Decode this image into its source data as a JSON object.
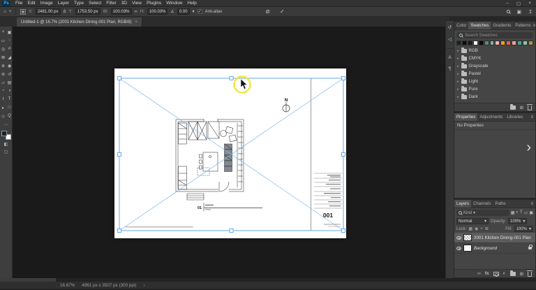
{
  "app": {
    "logo_text": "Ps",
    "minimize": "–",
    "restore": "▢",
    "close": "×"
  },
  "menubar": {
    "items": [
      "File",
      "Edit",
      "Image",
      "Layer",
      "Type",
      "Select",
      "Filter",
      "3D",
      "View",
      "Plugins",
      "Window",
      "Help"
    ]
  },
  "options": {
    "home_glyph": "⌂",
    "tool_glyph": "+",
    "caret": "▾",
    "x_label": "X:",
    "x_value": "2481.00 px",
    "delta_glyph": "Δ",
    "y_label": "Y:",
    "y_value": "1753.50 px",
    "w_label": "W:",
    "w_value": "100.03%",
    "link_glyph": "∞",
    "h_label": "H:",
    "h_value": "100.03%",
    "angle_glyph": "∠",
    "angle_value": "0.00",
    "antialias_check": "✓",
    "antialias_label": "Anti-alias",
    "cancel_glyph": "⊘",
    "commit_glyph": "✓",
    "workspace_glyph": "▣",
    "share_glyph": "↥"
  },
  "document_tab": {
    "title": "Untitled-1 @ 16.7% (2001 Kitchen Dining-001 Plan, RGB/8)",
    "close_glyph": "×"
  },
  "tools": {
    "items": [
      {
        "name": "move",
        "glyph": "+"
      },
      {
        "name": "artboard",
        "glyph": "▣"
      },
      {
        "name": "marquee",
        "glyph": "▭"
      },
      {
        "name": "lasso",
        "glyph": "◌"
      },
      {
        "name": "quick-selection",
        "glyph": "◎"
      },
      {
        "name": "crop",
        "glyph": "#"
      },
      {
        "name": "frame",
        "glyph": "⊠"
      },
      {
        "name": "eyedropper",
        "glyph": "◢"
      },
      {
        "name": "healing-brush",
        "glyph": "⊕"
      },
      {
        "name": "brush",
        "glyph": "◉"
      },
      {
        "name": "clone-stamp",
        "glyph": "⊚"
      },
      {
        "name": "history-brush",
        "glyph": "↺"
      },
      {
        "name": "eraser",
        "glyph": "▱"
      },
      {
        "name": "gradient",
        "glyph": "▤"
      },
      {
        "name": "blur",
        "glyph": "◔"
      },
      {
        "name": "dodge",
        "glyph": "◑"
      },
      {
        "name": "pen",
        "glyph": "ℓ"
      },
      {
        "name": "type",
        "glyph": "T"
      },
      {
        "name": "path-selection",
        "glyph": "▸"
      },
      {
        "name": "shape",
        "glyph": "□"
      },
      {
        "name": "hand",
        "glyph": "◇"
      },
      {
        "name": "zoom",
        "glyph": "Q"
      }
    ],
    "ellipsis": "⋯",
    "quick_mask": "◧",
    "screen_mode": "▢",
    "foreground_color": "#16242e",
    "background_color": "#ffffff"
  },
  "canvas": {
    "north_label": "N",
    "detail_number": "01",
    "sheet_number": "001",
    "transform_accent": "#66a9ea",
    "highlight_color": "#f2e73c"
  },
  "collapsed_panels": {
    "items": [
      {
        "name": "history",
        "glyph": "↺"
      },
      {
        "name": "notes",
        "glyph": "◁"
      },
      {
        "name": "character",
        "glyph": "A"
      },
      {
        "name": "paragraph",
        "glyph": "¶"
      }
    ]
  },
  "swatches_panel": {
    "tabs": [
      "Color",
      "Swatches",
      "Gradients",
      "Patterns"
    ],
    "menu_glyph": "≡",
    "search_placeholder": "Search Swatches",
    "colors": [
      "#16232b",
      "#0a0d10",
      "#181b1e",
      "#ffffff",
      "#0b0b0b",
      "#5f8a74",
      "#8fae9b",
      "#f2b1b6",
      "#e3a612",
      "#ef5a4e",
      "#efa193",
      "#4fa08f",
      "#8cc3b4",
      "#b28f3e"
    ],
    "folders": [
      "RGB",
      "CMYK",
      "Grayscale",
      "Pastel",
      "Light",
      "Pure",
      "Dark"
    ],
    "folder_caret": "▸",
    "new_glyph": "⊞"
  },
  "properties_panel": {
    "tabs": [
      "Properties",
      "Adjustments",
      "Libraries"
    ],
    "menu_glyph": "≡",
    "empty_text": "No Properties",
    "expand_glyph": "›"
  },
  "layers_panel": {
    "tabs": [
      "Layers",
      "Channels",
      "Paths"
    ],
    "menu_glyph": "≡",
    "filter_label": "Kind",
    "filter_caret": "▾",
    "filter_icons": [
      "▦",
      "◐",
      "T",
      "▭",
      "▣"
    ],
    "blend_mode": "Normal",
    "opacity_label": "Opacity:",
    "opacity_value": "100%",
    "lock_label": "Lock:",
    "lock_icons": [
      "▦",
      "◉",
      "+",
      "⊞"
    ],
    "fill_label": "Fill:",
    "fill_value": "100%",
    "layers": [
      {
        "name": "2001 Kitchen Dining-001 Plan"
      },
      {
        "name": "Background"
      }
    ],
    "footer": {
      "link": "∞",
      "fx": "fx",
      "adjustment": "◐",
      "new": "⊞"
    }
  },
  "status_bar": {
    "zoom": "16.67%",
    "doc_info": "4961 px x 3507 px (300 ppi)",
    "caret": "›"
  }
}
